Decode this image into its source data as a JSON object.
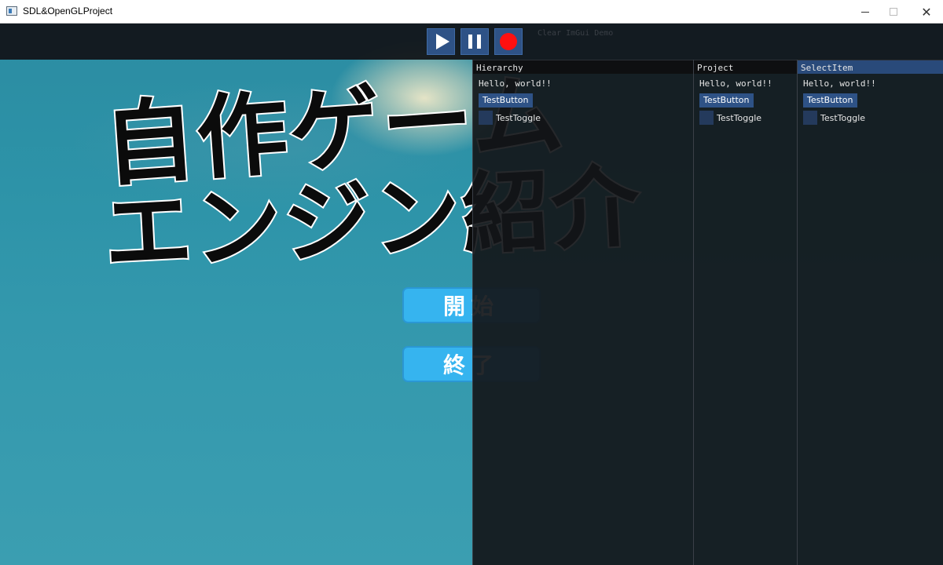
{
  "window": {
    "title": "SDL&OpenGLProject",
    "controls": {
      "minimize_icon": "minimize-icon",
      "maximize_icon": "maximize-icon",
      "close_glyph": "✕"
    }
  },
  "toolbar": {
    "play_icon": "play-icon",
    "pause_icon": "pause-icon",
    "record_icon": "record-icon",
    "clear_label": "Clear ImGui Demo",
    "accent_color": "#2e5286",
    "record_color": "#ff1010"
  },
  "game": {
    "title_line1": "自作ゲーム",
    "title_line2": "エンジン紹介",
    "menu": {
      "start": "開始",
      "end": "終了"
    },
    "button_color": "#36b4ef"
  },
  "panels": {
    "hierarchy": {
      "title": "Hierarchy",
      "hello": "Hello, world!!",
      "button": "TestButton",
      "toggle": "TestToggle"
    },
    "project": {
      "title": "Project",
      "hello": "Hello, world!!",
      "button": "TestButton",
      "toggle": "TestToggle"
    },
    "select_item": {
      "title": "SelectItem",
      "hello": "Hello, world!!",
      "button": "TestButton",
      "toggle": "TestToggle"
    }
  }
}
